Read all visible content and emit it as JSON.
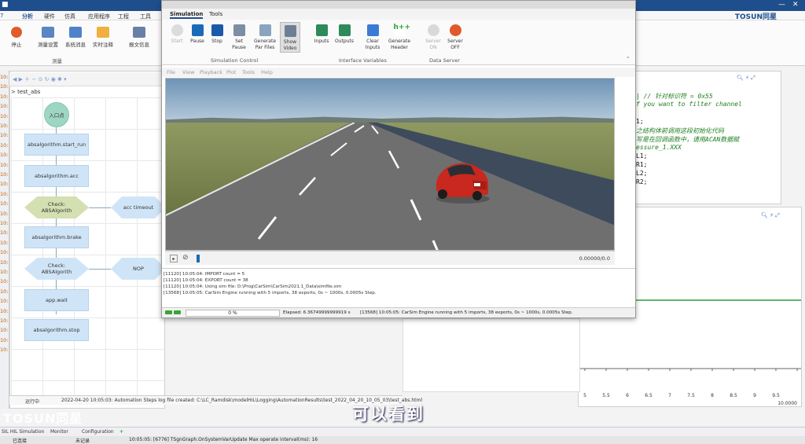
{
  "app": {
    "brand": "TOSUN同星",
    "title_bar_left": "7",
    "tabs": [
      "分析",
      "硬件",
      "仿真",
      "应用程序",
      "工程",
      "工具"
    ],
    "ribbon_buttons": [
      "停止",
      "测量设置",
      "系统消息",
      "实时注释",
      "报文信息"
    ],
    "ribbon_group": "测量",
    "accent": "#1f4e8c"
  },
  "editor": {
    "breadcrumb": "test_abs",
    "timestamps": [
      "10:",
      "10:",
      "10:",
      "10:",
      "10:",
      "10:",
      "10:",
      "10:",
      "10:",
      "10:",
      "10:",
      "10:",
      "10:",
      "10:",
      "10:",
      "10:",
      "10:",
      "10:",
      "10:",
      "10:",
      "10:",
      "10:",
      "10:",
      "10:",
      "10:",
      "10:",
      "10:",
      "10:",
      "10:"
    ],
    "flow": {
      "start": "入口点",
      "n1": "absalgorithm.start_run",
      "n2": "absalgorithm.acc",
      "d1": "Check: ABSAlgorith",
      "d1_side": "acc timeout",
      "n3": "absalgorithm.brake",
      "d2": "Check: ABSAlgorith",
      "d2_side": "NOP",
      "n4": "app.wait",
      "n5": "absalgorithm.stop"
    },
    "status_label": "运行中",
    "status_msg": "2022-04-20 10:05:03: Automation Steps log file created: C:\\LC_Ramdisk\\modelHIL\\Logging\\AutomationResults\\test_2022_04_20_10_05_03\\test_abs.html"
  },
  "simulink": {
    "tabs": [
      "Simulation",
      "Tools"
    ],
    "buttons": {
      "start": "Start",
      "pause": "Pause",
      "stop": "Stop",
      "set_pause": "Set\nPause",
      "gen_par": "Generate\nPar Files",
      "show_video": "Show\nVideo",
      "inputs": "Inputs",
      "outputs": "Outputs",
      "clear_inputs": "Clear\nInputs",
      "gen_header": "Generate\nHeader",
      "server_on": "Server\nON",
      "server_off": "Server\nOFF"
    },
    "groups": {
      "sim_control": "Simulation Control",
      "iface": "Interface Variables",
      "data_server": "Data Server"
    },
    "menu": [
      "File",
      "View",
      "Playback",
      "Plot",
      "Tools",
      "Help"
    ],
    "timecode": "0.00000/0.0",
    "log": [
      "[11120] 10:05:04: IMPORT count = 5",
      "[11120] 10:05:04: EXPORT count = 38",
      "[11120] 10:05:04: Using sim file: D:\\Prog\\CarSim\\CarSim2021.1_Data\\simfile.sim",
      "[13568] 10:05:05: CarSim Engine running with 5 imports, 38 exports, 0s ~ 1000s, 0.0005s Step."
    ],
    "progress": "0 %",
    "elapsed": "Elapsed: 6.36749999999919 s",
    "status_msg": "[13568] 10:05:05: CarSim Engine running with 5 imports, 38 exports, 0s ~ 1000s, 0.0005s Step."
  },
  "code": {
    "lines": [
      "| // 针对标识符 = 0x55",
      "f you want to filter channel",
      "",
      "1;",
      "之结构体前调用这段初始化代码",
      "写是在回调函数中，请用ACAN数据赋",
      "essure_1.XXX",
      "L1;",
      "R1;",
      "L2;",
      "R2;"
    ]
  },
  "chart_data": {
    "type": "line",
    "x_ticks": [
      "5",
      "5.5",
      "6",
      "6.5",
      "7",
      "7.5",
      "8",
      "8.5",
      "9",
      "9.5",
      "10.0000"
    ],
    "series_color": "#2a9d3a"
  },
  "bottom": {
    "tabs": [
      "SIL HIL Simulation",
      "Monitor",
      "Configuration"
    ],
    "add": "+",
    "status": [
      "已连接",
      "未记录",
      "10:05:05: [6776] TSgnGraph.OnSystemVarUpdate Max operate interval(ms): 16"
    ]
  },
  "subtitle": "可以看到",
  "watermark": "TOSUN同星"
}
